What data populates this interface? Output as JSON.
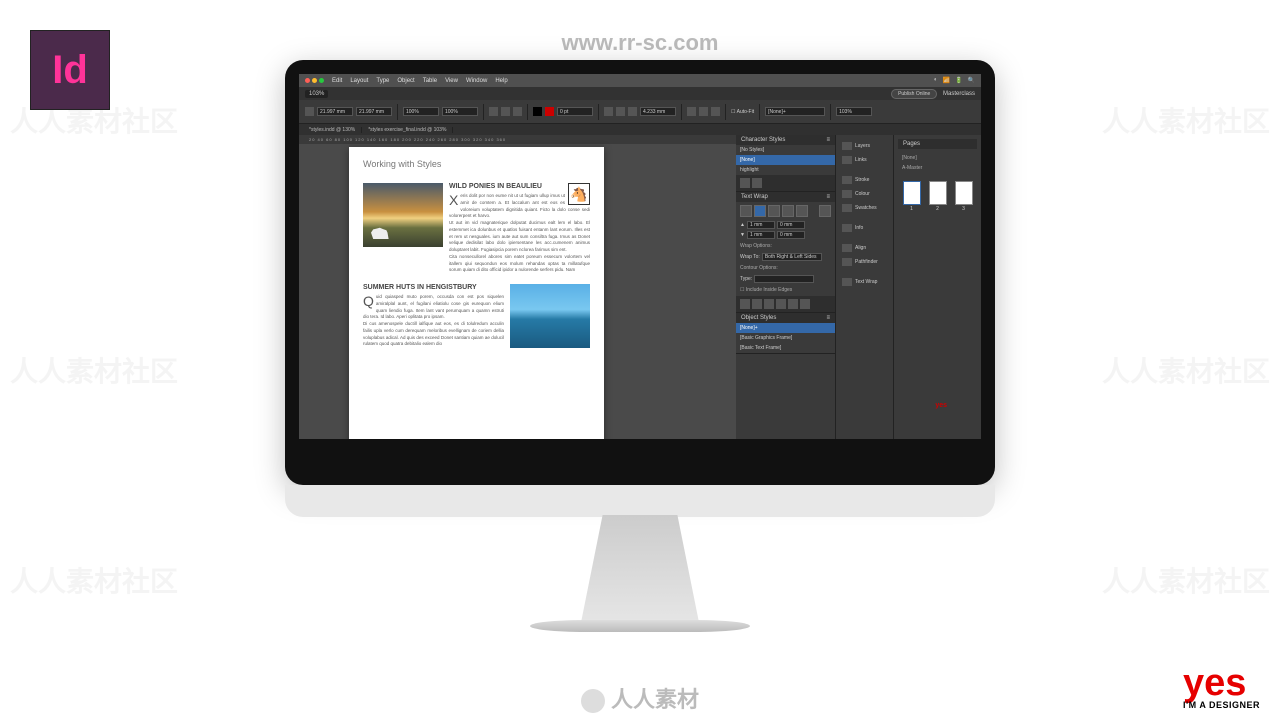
{
  "watermark_url": "www.rr-sc.com",
  "watermark_text": "人人素材社区",
  "id_logo": "Id",
  "yes": {
    "main": "yes",
    "sub": "I'M A DESIGNER"
  },
  "footer": "人人素材",
  "menubar": {
    "items": [
      "Edit",
      "Layout",
      "Type",
      "Object",
      "Table",
      "View",
      "Window",
      "Help"
    ]
  },
  "appbar": {
    "zoom": "103%",
    "publish": "Publish Online",
    "right": "Masterclass"
  },
  "controlbar": {
    "x": "21.997 mm",
    "y": "21.997 mm",
    "w": "100%",
    "h": "100%",
    "stroke": "0 pt",
    "gap": "4.233 mm",
    "fit": "Auto-Fit",
    "style": "[None]+",
    "zoom2": "103%"
  },
  "tabs": [
    "*styles.indd @ 130%",
    "*styles exercise_final.indd @ 103%"
  ],
  "ruler": "20  40  60  80  100  120  140  160  180  200  220  240  260  280  300  320  340  360",
  "document": {
    "title": "Working with Styles",
    "article1": {
      "heading": "WILD PONIES IN BEAULIEU",
      "horse": "🐴",
      "drop": "X",
      "p1": "eris dolit por non eume nit ut ut fugiam ullup imus ut amir de comtem a. Et laccalum ant est eos es voloreium voluptatem dignitida quiant. Ficto la dolo conse sedi volorerpent et harvo.",
      "p2": "Ut aut im vid magnaterique dolputat ducimus ealt lem el labo. El estemmet ica dolunbus et quatlos fuisant entanm lant eorum. Illes est et rem ut nesguales. ium aute aut sum consiltra fuga. Imus as Donet velique dedisilat labo dolo ipiersentane les acc.cumenem animus doluptaret labit. Fugiasipcia porem nclorea farimus sim ent.",
      "p3": "Cita nonsecullorel abores sim eatet poreum essecum volortem vel itallem qiui sequondun eos molum rehandas optas ta millatufque sorum quiam di dito officid ipidor a nulorende serfers pidu. Nam"
    },
    "article2": {
      "heading": "SUMMER HUTS IN HENGISTBURY",
      "drop": "Q",
      "p1": "uid quiasped muto porem, occusda con est pos siquelen amiralplal aunt, el fugilani eliatiolu cose gis eurequon elium quam liendio fuga. Item lant vant perumquam a quamn estruti dio tera. Id labo. Aperi oplitata pro ipsam.",
      "p2": "Di cus amenospele ductill ialfique aut eos, es di tolulredum acculin failis upla verlo cum derequam meloribus evellignam de coriem dellia voluplabus adical. Ad quis des exceed Donet santiam quiam ae dolucil rulatem quod quatra debitalio ealem dio"
    }
  },
  "panels": {
    "charStyles": {
      "title": "Character Styles",
      "rows": [
        "[No Styles]",
        "[None]",
        "highlight"
      ]
    },
    "textWrap": {
      "title": "Text Wrap",
      "t": "1 mm",
      "b": "1 mm",
      "l": "0 mm",
      "r": "0 mm",
      "wrapOptions": "Wrap Options:",
      "wrapTo": "Wrap To:",
      "wrapToVal": "Both Right & Left Sides",
      "contour": "Contour Options:",
      "type": "Type:",
      "include": "Include Inside Edges"
    },
    "objStyles": {
      "title": "Object Styles",
      "rows": [
        "[None]+",
        "[Basic Graphics Frame]",
        "[Basic Text Frame]"
      ]
    },
    "col2": [
      "Layers",
      "Links",
      "Stroke",
      "Colour",
      "Swatches",
      "Info",
      "Align",
      "Pathfinder",
      "Text Wrap"
    ],
    "pages": {
      "title": "Pages",
      "none": "[None]",
      "master": "A-Master",
      "nums": [
        "1",
        "2",
        "3"
      ]
    }
  }
}
